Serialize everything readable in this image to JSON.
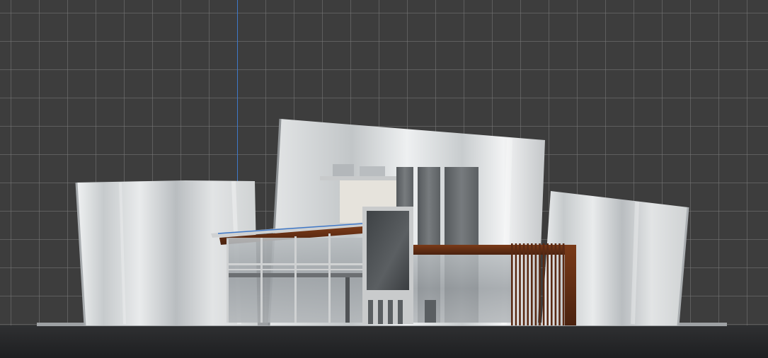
{
  "viewport": {
    "label": "",
    "background_color": "#3d3d3d",
    "grid_line_color": "#787878",
    "guide_line_color": "#3f78c8",
    "ground_color": "#1e1f21"
  },
  "model": {
    "surface_colors": {
      "curved_panels": "#d6dadc",
      "glass": "#a4a9ad",
      "timber": "#5a2a14",
      "concrete_frame": "#c9cbcc",
      "dark_glass": "#4d5154"
    }
  }
}
